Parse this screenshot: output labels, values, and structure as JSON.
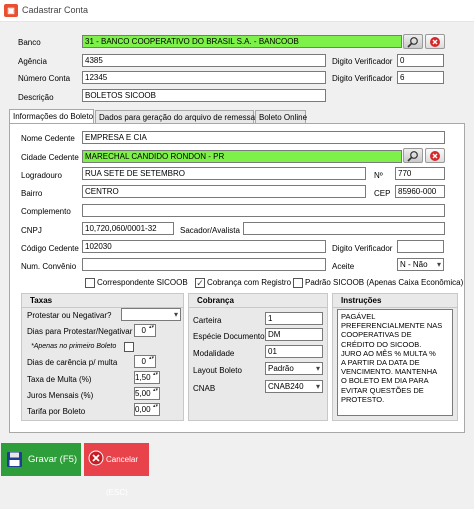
{
  "window": {
    "title": "Cadastrar Conta"
  },
  "banco": {
    "label": "Banco",
    "value": "31 - BANCO COOPERATIVO DO BRASIL S.A. - BANCOOB"
  },
  "agencia": {
    "label": "Agência",
    "value": "4385"
  },
  "agencia_dv": {
    "label": "Digito Verificador",
    "value": "0"
  },
  "conta": {
    "label": "Número Conta",
    "value": "12345"
  },
  "conta_dv": {
    "label": "Digito Verificador",
    "value": "6"
  },
  "descricao": {
    "label": "Descrição",
    "value": "BOLETOS SICOOB"
  },
  "tabs": [
    "Informações do Boleto",
    "Dados para geração do arquivo de remessa",
    "Boleto Online"
  ],
  "boleto": {
    "cedente": {
      "label": "Nome Cedente",
      "value": "EMPRESA E CIA"
    },
    "cidade": {
      "label": "Cidade Cedente",
      "value": "MARECHAL CANDIDO RONDON - PR"
    },
    "logradouro": {
      "label": "Logradouro",
      "value": "RUA SETE DE SETEMBRO"
    },
    "numero": {
      "label": "Nº",
      "value": "770"
    },
    "bairro": {
      "label": "Bairro",
      "value": "CENTRO"
    },
    "cep": {
      "label": "CEP",
      "value": "85960-000"
    },
    "complemento": {
      "label": "Complemento",
      "value": ""
    },
    "cnpj": {
      "label": "CNPJ",
      "value": "10,720,060/0001-32"
    },
    "sacador": {
      "label": "Sacador/Avalista",
      "value": ""
    },
    "codigo_cedente": {
      "label": "Código Cedente",
      "value": "102030"
    },
    "codigo_dv": {
      "label": "Digito Verificador",
      "value": ""
    },
    "convenio": {
      "label": "Num. Convênio",
      "value": ""
    },
    "aceite": {
      "label": "Aceite",
      "value": "N - Não"
    },
    "checks": [
      {
        "label": "Correspondente SICOOB",
        "checked": false
      },
      {
        "label": "Cobrança com Registro",
        "checked": true
      },
      {
        "label": "Padrão SICOOB (Apenas Caixa Econômica)",
        "checked": false
      }
    ]
  },
  "taxas": {
    "title": "Taxas",
    "protestar": {
      "label": "Protestar ou Negativar?",
      "value": ""
    },
    "dias_protestar": {
      "label": "Dias para Protestar/Negativar",
      "value": "0"
    },
    "apenas": {
      "label": "*Apenas no primeiro Boleto"
    },
    "carencia": {
      "label": "Dias de carência p/ multa",
      "value": "0"
    },
    "multa": {
      "label": "Taxa de Multa (%)",
      "value": "1,50"
    },
    "juros": {
      "label": "Juros Mensais (%)",
      "value": "5,00"
    },
    "tarifa": {
      "label": "Tarifa por Boleto",
      "value": "0,00"
    }
  },
  "cobranca": {
    "title": "Cobrança",
    "carteira": {
      "label": "Carteira",
      "value": "1"
    },
    "especie": {
      "label": "Espécie Documento",
      "value": "DM"
    },
    "modalidade": {
      "label": "Modalidade",
      "value": "01"
    },
    "layout": {
      "label": "Layout Boleto",
      "value": "Padrão"
    },
    "cnab": {
      "label": "CNAB",
      "value": "CNAB240"
    }
  },
  "instrucoes": {
    "title": "Instruções",
    "lines": [
      "PAGÁVEL",
      "PREFERENCIALMENTE NAS",
      "COOPERATIVAS DE",
      "CRÉDITO DO SICOOB.",
      "JURO AO MÊS % MULTA %",
      "A PARTIR DA DATA DE",
      "VENCIMENTO. MANTENHA",
      "O BOLETO EM DIA PARA",
      "EVITAR QUESTÕES DE",
      "PROTESTO."
    ]
  },
  "footer": {
    "save_label": "Gravar (F5)",
    "cancel_label": "Cancelar (ESC)",
    "save_color": "#2e9e3a",
    "cancel_color": "#e8424a"
  }
}
